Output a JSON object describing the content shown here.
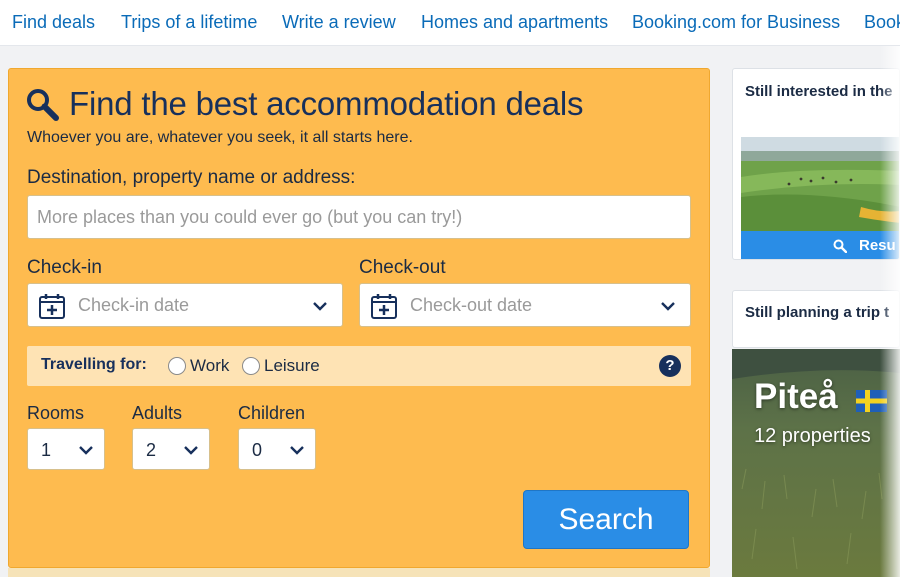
{
  "nav": {
    "items": [
      {
        "label": "Find deals"
      },
      {
        "label": "Trips of a lifetime"
      },
      {
        "label": "Write a review"
      },
      {
        "label": "Homes and apartments"
      },
      {
        "label": "Booking.com for Business"
      },
      {
        "label": "Book"
      }
    ]
  },
  "search": {
    "title": "Find the best accommodation deals",
    "subtitle": "Whoever you are, whatever you seek, it all starts here.",
    "destination_label": "Destination, property name or address:",
    "destination_placeholder": "More places than you could ever go (but you can try!)",
    "checkin_label": "Check-in",
    "checkin_placeholder": "Check-in date",
    "checkout_label": "Check-out",
    "checkout_placeholder": "Check-out date",
    "travelling_for_label": "Travelling for:",
    "purpose_options": [
      "Work",
      "Leisure"
    ],
    "rooms_label": "Rooms",
    "rooms_value": "1",
    "adults_label": "Adults",
    "adults_value": "2",
    "children_label": "Children",
    "children_value": "0",
    "search_button": "Search"
  },
  "sidebar": {
    "card1_title": "Still interested in the",
    "card1_button": "Resu",
    "card2_title": "Still planning a trip t",
    "destination_name": "Piteå",
    "destination_properties": "12 properties"
  },
  "colors": {
    "panel": "#febb4f",
    "accent_blue": "#2a8de6",
    "nav_link": "#0a6bb8",
    "text_dark": "#17305c"
  },
  "icons": [
    "search-icon",
    "calendar-icon",
    "chevron-down-icon",
    "help-icon",
    "sweden-flag-icon"
  ]
}
